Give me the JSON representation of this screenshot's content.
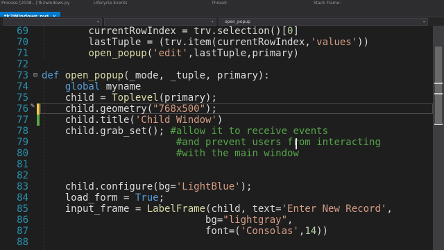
{
  "topbar": {
    "items": [
      "Process:",
      "[2038...] tk2windows.py",
      "Lifecycle Events",
      "Thread:",
      "Stack Frame:"
    ]
  },
  "tab": {
    "label": "tk2Windows.py*",
    "close": "×"
  },
  "navbar": {
    "member_label": "open_popup"
  },
  "lines": [
    {
      "n": "69",
      "tokens": [
        {
          "t": "        currentRowIndex = trv.selection()[",
          "c": ""
        },
        {
          "t": "0",
          "c": "num"
        },
        {
          "t": "]",
          "c": ""
        }
      ]
    },
    {
      "n": "70",
      "tokens": [
        {
          "t": "        lastTuple = (trv.item(currentRowIndex,",
          "c": ""
        },
        {
          "t": "'values'",
          "c": "str"
        },
        {
          "t": "))",
          "c": ""
        }
      ]
    },
    {
      "n": "71",
      "tokens": [
        {
          "t": "        ",
          "c": ""
        },
        {
          "t": "open_popup",
          "c": "fn"
        },
        {
          "t": "(",
          "c": ""
        },
        {
          "t": "'edit'",
          "c": "str"
        },
        {
          "t": ",lastTuple,primary)",
          "c": ""
        }
      ]
    },
    {
      "n": "72",
      "tokens": []
    },
    {
      "n": "73",
      "tokens": [
        {
          "t": "def ",
          "c": "kw"
        },
        {
          "t": "open_popup",
          "c": "fn"
        },
        {
          "t": "(_mode, _tuple, primary):",
          "c": ""
        }
      ]
    },
    {
      "n": "74",
      "tokens": [
        {
          "t": "    ",
          "c": ""
        },
        {
          "t": "global",
          "c": "kw"
        },
        {
          "t": " myname",
          "c": ""
        }
      ]
    },
    {
      "n": "75",
      "tokens": [
        {
          "t": "    child = ",
          "c": ""
        },
        {
          "t": "Toplevel",
          "c": "fn"
        },
        {
          "t": "(primary);",
          "c": ""
        }
      ]
    },
    {
      "n": "76",
      "tokens": [
        {
          "t": "    child.geometry(",
          "c": ""
        },
        {
          "t": "\"768x500\"",
          "c": "str"
        },
        {
          "t": ");",
          "c": ""
        }
      ]
    },
    {
      "n": "77",
      "tokens": [
        {
          "t": "    child.title(",
          "c": ""
        },
        {
          "t": "'Child Window'",
          "c": "str"
        },
        {
          "t": ")",
          "c": ""
        }
      ]
    },
    {
      "n": "78",
      "tokens": [
        {
          "t": "    child.grab_set(); ",
          "c": ""
        },
        {
          "t": "#allow it to receive events",
          "c": "com"
        }
      ]
    },
    {
      "n": "79",
      "tokens": [
        {
          "t": "                       ",
          "c": ""
        },
        {
          "t": "#and prevent users from interacting",
          "c": "com"
        }
      ]
    },
    {
      "n": "80",
      "tokens": [
        {
          "t": "                       ",
          "c": ""
        },
        {
          "t": "#with the main window",
          "c": "com"
        }
      ]
    },
    {
      "n": "81",
      "tokens": []
    },
    {
      "n": "82",
      "tokens": []
    },
    {
      "n": "83",
      "tokens": [
        {
          "t": "    child.configure(bg=",
          "c": ""
        },
        {
          "t": "'LightBlue'",
          "c": "str"
        },
        {
          "t": ");",
          "c": ""
        }
      ]
    },
    {
      "n": "84",
      "tokens": [
        {
          "t": "    load_form = ",
          "c": ""
        },
        {
          "t": "True",
          "c": "kw"
        },
        {
          "t": ";",
          "c": ""
        }
      ]
    },
    {
      "n": "85",
      "tokens": [
        {
          "t": "    input_frame = ",
          "c": ""
        },
        {
          "t": "LabelFrame",
          "c": "fn"
        },
        {
          "t": "(child, text=",
          "c": ""
        },
        {
          "t": "'Enter New Record'",
          "c": "str"
        },
        {
          "t": ",",
          "c": ""
        }
      ]
    },
    {
      "n": "86",
      "tokens": [
        {
          "t": "                            bg=",
          "c": ""
        },
        {
          "t": "\"lightgray\"",
          "c": "str"
        },
        {
          "t": ",",
          "c": ""
        }
      ]
    },
    {
      "n": "87",
      "tokens": [
        {
          "t": "                            font=(",
          "c": ""
        },
        {
          "t": "'Consolas'",
          "c": "str"
        },
        {
          "t": ",",
          "c": ""
        },
        {
          "t": "14",
          "c": "num"
        },
        {
          "t": "))",
          "c": ""
        }
      ]
    },
    {
      "n": "88",
      "tokens": []
    }
  ],
  "colors": {
    "modified_line": "#f2c94c",
    "saved_line": "#57a64a"
  }
}
